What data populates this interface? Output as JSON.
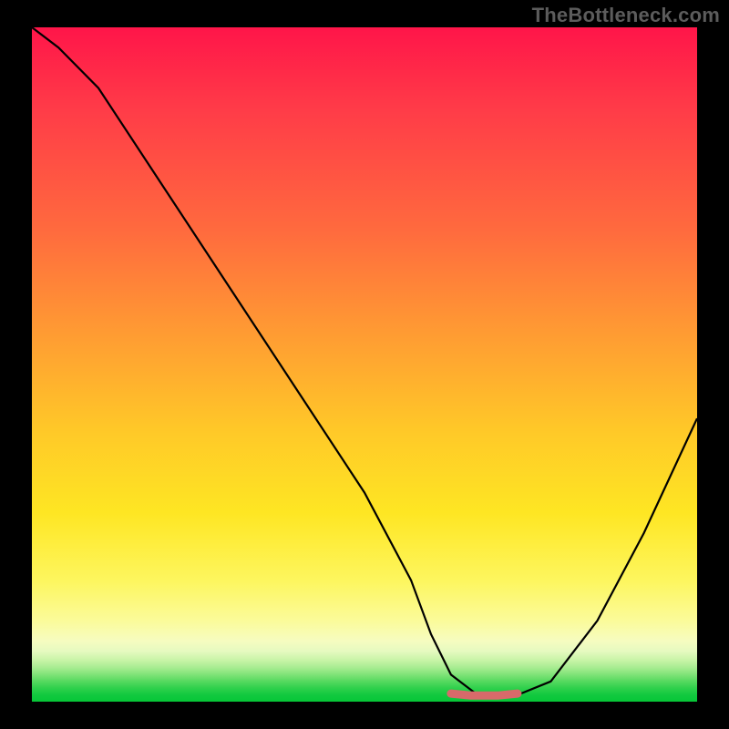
{
  "watermark": "TheBottleneck.com",
  "chart_data": {
    "type": "line",
    "title": "",
    "xlabel": "",
    "ylabel": "",
    "xlim": [
      0,
      100
    ],
    "ylim": [
      0,
      100
    ],
    "grid": false,
    "series": [
      {
        "name": "bottleneck-curve",
        "x": [
          0,
          4,
          10,
          20,
          30,
          40,
          50,
          57,
          60,
          63,
          67,
          71,
          73,
          78,
          85,
          92,
          100
        ],
        "y": [
          100,
          97,
          91,
          76,
          61,
          46,
          31,
          18,
          10,
          4,
          1,
          1,
          1,
          3,
          12,
          25,
          42
        ]
      }
    ],
    "highlight": {
      "name": "optimal-zone",
      "x": [
        63,
        66,
        70,
        73
      ],
      "y": [
        1.2,
        0.9,
        0.9,
        1.2
      ]
    },
    "background": {
      "type": "vertical-gradient",
      "stops": [
        {
          "pos": 0.0,
          "color": "#ff1549"
        },
        {
          "pos": 0.3,
          "color": "#ff6a3e"
        },
        {
          "pos": 0.6,
          "color": "#ffc928"
        },
        {
          "pos": 0.88,
          "color": "#fbfb9a"
        },
        {
          "pos": 1.0,
          "color": "#06c637"
        }
      ]
    }
  }
}
